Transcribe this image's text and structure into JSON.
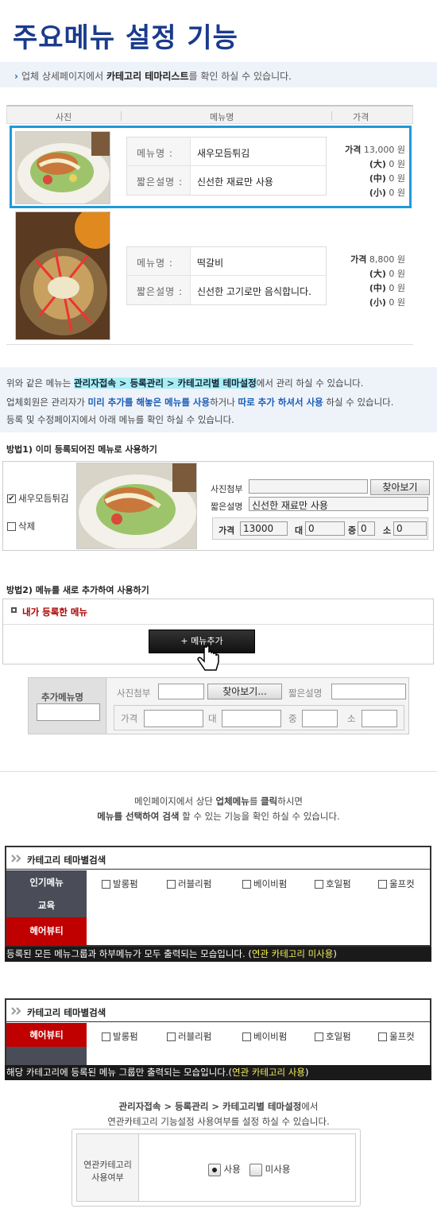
{
  "title": "주요메뉴 설정 기능",
  "intro": {
    "prefix": "업체 상세페이지에서 ",
    "bold": "카테고리 테마리스트",
    "suffix": "를 확인 하실 수 있습니다."
  },
  "table": {
    "headers": [
      "사진",
      "메뉴명",
      "가격"
    ],
    "rows": [
      {
        "menu_label": "메뉴명 :",
        "menu_value": "새우모듬튀김",
        "desc_label": "짧은설명 :",
        "desc_value": "신선한 재료만 사용",
        "price_label": "가격",
        "price": "13,000 원",
        "large_label": "(大)",
        "large": "0 원",
        "medium_label": "(中)",
        "medium": "0 원",
        "small_label": "(小)",
        "small": "0 원"
      },
      {
        "menu_label": "메뉴명 :",
        "menu_value": "떡갈비",
        "desc_label": "짧은설명 :",
        "desc_value": "신선한 고기로만 음식합니다.",
        "price_label": "가격",
        "price": "8,800 원",
        "large_label": "(大)",
        "large": "0 원",
        "medium_label": "(中)",
        "medium": "0 원",
        "small_label": "(小)",
        "small": "0 원"
      }
    ]
  },
  "info": {
    "l1a": "위와 같은 메뉴는 ",
    "l1b": "관리자접속 > 등록관리 > 카테고리별 테마설정",
    "l1c": "에서 관리 하실 수 있습니다.",
    "l2a": "업체회원은 관리자가 ",
    "l2b": "미리 추가를 해놓은 메뉴를 사용",
    "l2c": "하거나 ",
    "l2d": "따로 추가 하셔서 사용",
    "l2e": " 하실 수 있습니다.",
    "l3": "등록 및 수정페이지에서 아래 메뉴를 확인 하실 수 있습니다."
  },
  "method1": {
    "title": "방법1) 이미 등록되어진 메뉴로 사용하기",
    "check_label": "새우모듬튀김",
    "check_mark": "✔",
    "delete_label": "삭제",
    "photo_label": "사진첨부",
    "find_btn": "찾아보기",
    "desc_label": "짧은설명",
    "desc_value": "신선한 재료만 사용",
    "price_label": "가격",
    "price": "13000",
    "large_label": "대",
    "large": "0",
    "medium_label": "중",
    "medium": "0",
    "small_label": "소",
    "small": "0"
  },
  "method2": {
    "title": "방법2) 메뉴를 새로 추가하여 사용하기",
    "box_title": "내가 등록한 메뉴",
    "add_btn": "+ 메뉴추가",
    "form_label": "추가메뉴명",
    "photo_label": "사진첨부",
    "find_btn": "찾아보기...",
    "desc_label": "짧은설명",
    "price_label": "가격",
    "large_label": "대",
    "medium_label": "중",
    "small_label": "소"
  },
  "main_info": {
    "a": "메인페이지에서 상단 ",
    "b": "업체메뉴",
    "c": "를 ",
    "d": "클릭",
    "e": "하시면",
    "f": "메뉴를 선택하여 검색",
    "g": " 할 수 있는 기능을 확인 하실 수 있습니다."
  },
  "cat1": {
    "title": "카테고리 테마별검색",
    "side": [
      "인기메뉴",
      "교육",
      "헤어뷰티"
    ],
    "options": [
      "발롱펌",
      "러블리펌",
      "베이비펌",
      "호일펌",
      "울프컷"
    ],
    "bar_a": "등록된 모든 메뉴그룹과 하부메뉴가 모두 출력되는 모습입니다. (",
    "bar_b": "연관 카테고리 미사용",
    "bar_c": ")"
  },
  "cat2": {
    "title": "카테고리 테마별검색",
    "side": [
      "헤어뷰티"
    ],
    "options": [
      "발롱펌",
      "러블리펌",
      "베이비펌",
      "호일펌",
      "울프컷"
    ],
    "bar_a": "해당 카테고리에 등록된 메뉴 그룹만 출력되는 모습입니다.(",
    "bar_b": "연관 카테고리 사용",
    "bar_c": ")"
  },
  "setting": {
    "l1": "관리자접속 > 등록관리 > 카테고리별 테마설정",
    "l1s": "에서",
    "l2": "연관카테고리 기능설정 사용여부를 설정 하실 수 있습니다.",
    "label1": "연관카테고리",
    "label2": "사용여부",
    "use": "사용",
    "nouse": "미사용"
  },
  "colors": {
    "accent_blue": "#1e9ad8",
    "title_blue": "#1a3a8c",
    "dark_red": "#c00000",
    "side_gray": "#4a4d57"
  }
}
